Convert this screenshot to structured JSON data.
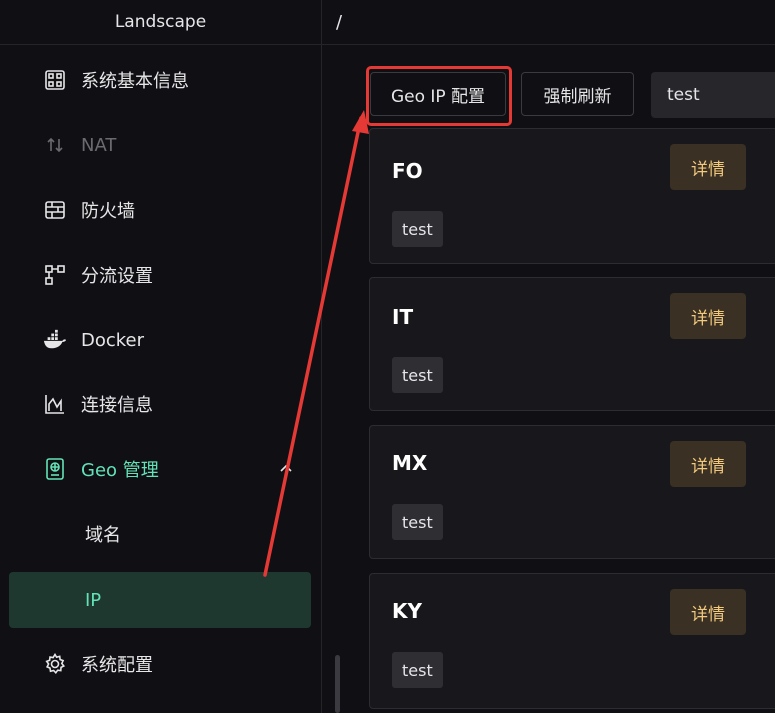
{
  "app": {
    "title": "Landscape"
  },
  "breadcrumb": "/",
  "sidebar": {
    "items": [
      {
        "label": "系统基本信息",
        "icon": "dashboard-icon"
      },
      {
        "label": "NAT",
        "icon": "swap-vertical-icon",
        "disabled": true
      },
      {
        "label": "防火墙",
        "icon": "firewall-icon"
      },
      {
        "label": "分流设置",
        "icon": "flow-icon"
      },
      {
        "label": "Docker",
        "icon": "docker-icon"
      },
      {
        "label": "连接信息",
        "icon": "chart-icon"
      },
      {
        "label": "Geo 管理",
        "icon": "geo-icon",
        "expanded": true
      },
      {
        "label": "域名",
        "sub": true
      },
      {
        "label": "IP",
        "sub": true,
        "selected": true
      },
      {
        "label": "系统配置",
        "icon": "gear-icon"
      }
    ]
  },
  "toolbar": {
    "geo_ip_config_label": "Geo IP 配置",
    "force_refresh_label": "强制刷新",
    "search_value": "test"
  },
  "cards": [
    {
      "title": "FO",
      "detail_label": "详情",
      "tag": "test"
    },
    {
      "title": "IT",
      "detail_label": "详情",
      "tag": "test"
    },
    {
      "title": "MX",
      "detail_label": "详情",
      "tag": "test"
    },
    {
      "title": "KY",
      "detail_label": "详情",
      "tag": "test"
    }
  ],
  "colors": {
    "accent": "#63e2b7",
    "warning": "#f2c97d",
    "annotation": "#e53935"
  }
}
